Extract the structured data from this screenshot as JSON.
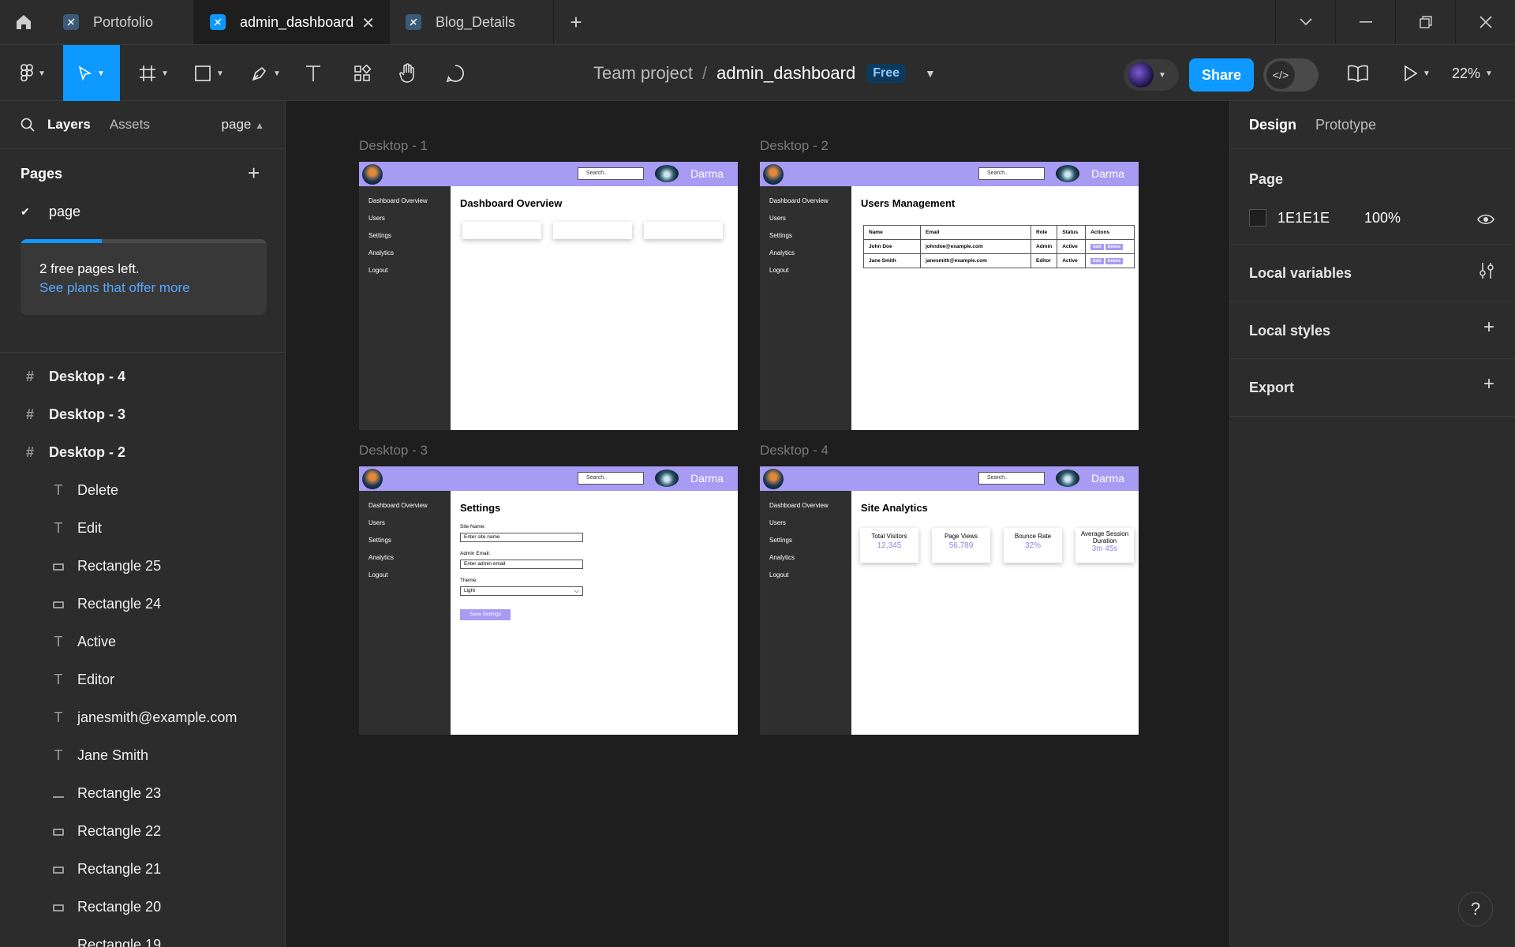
{
  "tabs": {
    "items": [
      {
        "label": "Portofolio"
      },
      {
        "label": "admin_dashboard"
      },
      {
        "label": "Blog_Details"
      }
    ],
    "close_glyph": "✕",
    "add_glyph": "+"
  },
  "toolbar": {
    "breadcrumb_project": "Team project",
    "breadcrumb_sep": "/",
    "file_name": "admin_dashboard",
    "plan_badge": "Free",
    "share_label": "Share",
    "zoom": "22%"
  },
  "left_panel": {
    "tab_layers": "Layers",
    "tab_assets": "Assets",
    "page_selector": "page",
    "pages_title": "Pages",
    "current_page": "page",
    "upsell_text": "2 free pages left.",
    "upsell_link": "See plans that offer more",
    "upsell_progress": 0.33,
    "layers": [
      {
        "name": "Desktop - 4",
        "type": "frame"
      },
      {
        "name": "Desktop - 3",
        "type": "frame"
      },
      {
        "name": "Desktop - 2",
        "type": "frame"
      },
      {
        "name": "Delete",
        "type": "text"
      },
      {
        "name": "Edit",
        "type": "text"
      },
      {
        "name": "Rectangle 25",
        "type": "rect"
      },
      {
        "name": "Rectangle 24",
        "type": "rect"
      },
      {
        "name": "Active",
        "type": "text"
      },
      {
        "name": "Editor",
        "type": "text"
      },
      {
        "name": "janesmith@example.com",
        "type": "text"
      },
      {
        "name": "Jane Smith",
        "type": "text"
      },
      {
        "name": "Rectangle 23",
        "type": "line"
      },
      {
        "name": "Rectangle 22",
        "type": "rect"
      },
      {
        "name": "Rectangle 21",
        "type": "rect"
      },
      {
        "name": "Rectangle 20",
        "type": "rect"
      },
      {
        "name": "Rectangle 19",
        "type": "line"
      }
    ]
  },
  "right_panel": {
    "tab_design": "Design",
    "tab_prototype": "Prototype",
    "page_section": "Page",
    "bg_hex": "1E1E1E",
    "bg_opacity": "100%",
    "local_variables": "Local variables",
    "local_styles": "Local styles",
    "export": "Export"
  },
  "canvas": {
    "frames": {
      "d1_label": "Desktop - 1",
      "d2_label": "Desktop - 2",
      "d3_label": "Desktop - 3",
      "d4_label": "Desktop - 4"
    },
    "mock": {
      "search_placeholder": "Search..",
      "user_name": "Darma",
      "nav": [
        "Dashboard Overview",
        "Users",
        "Settings",
        "Analytics",
        "Logout"
      ],
      "d1_title": "Dashboard Overview",
      "d2_title": "Users Management",
      "d3_title": "Settings",
      "d4_title": "Site Analytics",
      "table_headers": [
        "Name",
        "Email",
        "Role",
        "Status",
        "Actions"
      ],
      "table_rows": [
        {
          "name": "John Doe",
          "email": "johndoe@example.com",
          "role": "Admin",
          "status": "Active"
        },
        {
          "name": "Jane Smith",
          "email": "janesmith@example.com",
          "role": "Editor",
          "status": "Active"
        }
      ],
      "edit_label": "Edit",
      "delete_label": "Delete",
      "settings": {
        "site_name_label": "Site Name:",
        "site_name_placeholder": "Enter site name",
        "admin_email_label": "Admin Email:",
        "admin_email_placeholder": "Enter admin email",
        "theme_label": "Theme:",
        "theme_value": "Light",
        "save_label": "Save Settings"
      },
      "stats": [
        {
          "label": "Total Visitors",
          "value": "12,345"
        },
        {
          "label": "Page Views",
          "value": "56,789"
        },
        {
          "label": "Bounce Rate",
          "value": "32%"
        },
        {
          "label": "Average Session Duration",
          "value": "3m 45s"
        }
      ]
    }
  },
  "colors": {
    "accent": "#0d99ff",
    "mock_header": "#a79bf4",
    "mock_sidebar": "#2f2f2f",
    "canvas_bg": "#1e1e1e"
  }
}
